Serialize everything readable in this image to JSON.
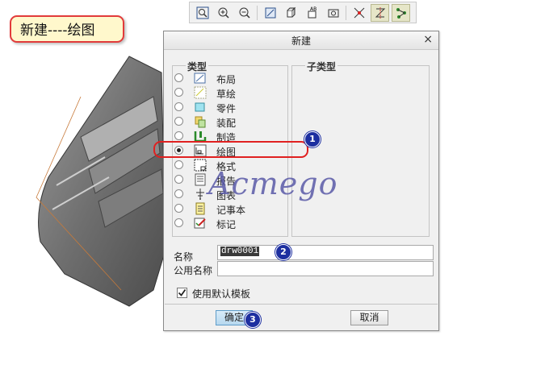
{
  "callout": {
    "text": "新建----绘图"
  },
  "toolbar": {
    "icons": [
      "zoom-fit-icon",
      "zoom-in-icon",
      "zoom-out-icon",
      "repaint-icon",
      "shaded-view-icon",
      "named-views-icon",
      "datum-display-icon",
      "spin-center-icon",
      "axis-display-icon",
      "point-display-icon"
    ]
  },
  "dialog": {
    "title": "新建",
    "close": "×",
    "type_label": "类型",
    "subtype_label": "子类型",
    "types": [
      {
        "label": "布局",
        "icon": "layout-icon",
        "selected": false
      },
      {
        "label": "草绘",
        "icon": "sketch-icon",
        "selected": false
      },
      {
        "label": "零件",
        "icon": "part-icon",
        "selected": false
      },
      {
        "label": "装配",
        "icon": "assembly-icon",
        "selected": false
      },
      {
        "label": "制造",
        "icon": "manufacturing-icon",
        "selected": false
      },
      {
        "label": "绘图",
        "icon": "drawing-icon",
        "selected": true
      },
      {
        "label": "格式",
        "icon": "format-icon",
        "selected": false
      },
      {
        "label": "报告",
        "icon": "report-icon",
        "selected": false
      },
      {
        "label": "图表",
        "icon": "diagram-icon",
        "selected": false
      },
      {
        "label": "记事本",
        "icon": "notebook-icon",
        "selected": false
      },
      {
        "label": "标记",
        "icon": "markup-icon",
        "selected": false
      }
    ],
    "name_label": "名称",
    "name_value": "drw0001",
    "common_name_label": "公用名称",
    "common_name_value": "",
    "use_default_template_label": "使用默认模板",
    "use_default_template_checked": true,
    "ok_label": "确定",
    "cancel_label": "取消"
  },
  "annotations": {
    "step1": "1",
    "step2": "2",
    "step3": "3",
    "watermark": "Acmego"
  },
  "colors": {
    "highlight": "#e02020",
    "step_badge": "#1d2fa0",
    "callout_bg": "#fff8cc"
  }
}
